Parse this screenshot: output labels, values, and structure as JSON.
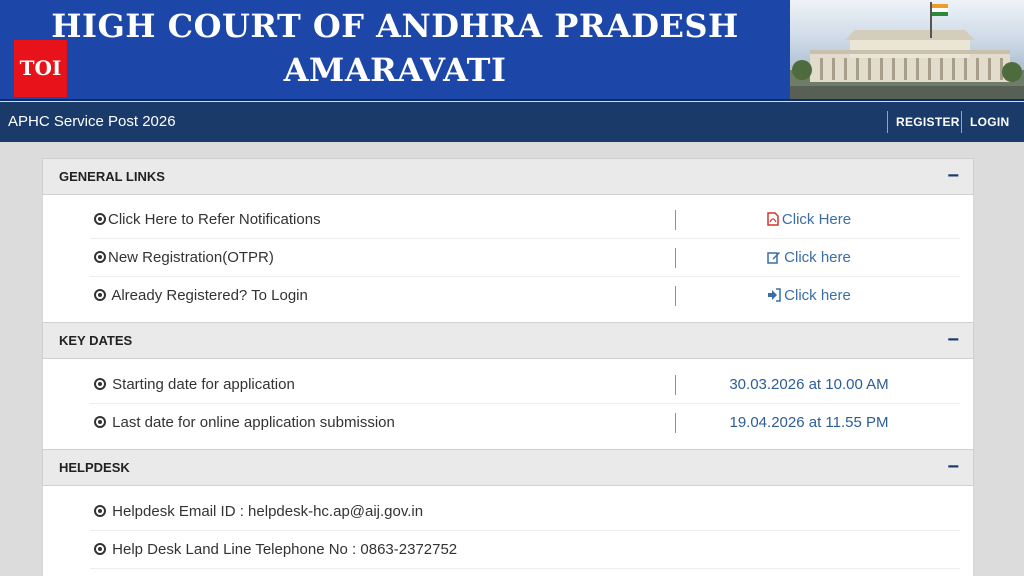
{
  "banner": {
    "title_line1": "HIGH COURT OF ANDHRA PRADESH",
    "title_line2": "AMARAVATI",
    "watermark": "TOI"
  },
  "navbar": {
    "title": "APHC Service Post 2026",
    "register_label": "REGISTER",
    "login_label": "LOGIN"
  },
  "general_links": {
    "heading": "GENERAL LINKS",
    "toggle": "−",
    "rows": [
      {
        "label": "Click Here to Refer Notifications",
        "action": "Click Here",
        "icon": "pdf-icon"
      },
      {
        "label": "New Registration(OTPR)",
        "action": "Click here",
        "icon": "edit-icon"
      },
      {
        "label": " Already Registered? To Login",
        "action": "Click here",
        "icon": "sign-in-icon"
      }
    ]
  },
  "key_dates": {
    "heading": "KEY DATES",
    "toggle": "−",
    "rows": [
      {
        "label": " Starting date for application",
        "value": "30.03.2026 at 10.00 AM"
      },
      {
        "label": " Last date for online application submission",
        "value": "19.04.2026 at 11.55 PM"
      }
    ]
  },
  "helpdesk": {
    "heading": "HELPDESK",
    "toggle": "−",
    "rows": [
      {
        "label": " Helpdesk Email ID : helpdesk-hc.ap@aij.gov.in"
      },
      {
        "label": " Help Desk Land Line Telephone No : 0863-2372752"
      }
    ]
  },
  "colors": {
    "banner_blue": "#1c47a8",
    "navbar_blue": "#1a3b6a",
    "link_blue": "#3a6ea5",
    "pdf_red": "#d9342b"
  }
}
